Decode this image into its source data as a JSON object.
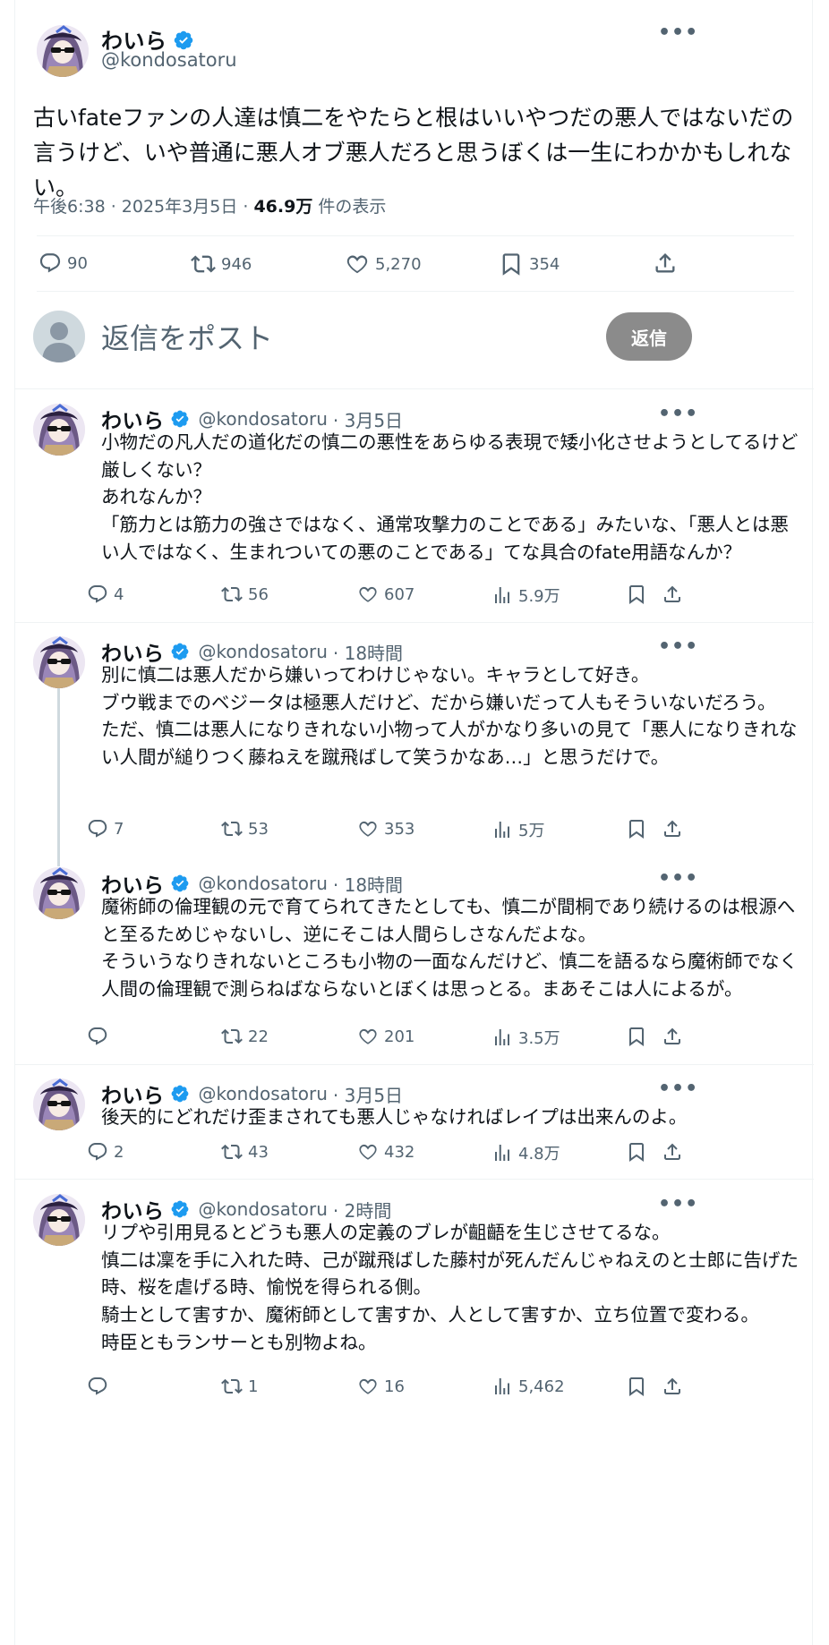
{
  "main_post": {
    "name": "わいら",
    "handle": "@kondosatoru",
    "text": "古いfateファンの人達は慎二をやたらと根はいいやつだの悪人ではないだの言うけど、いや普通に悪人オブ悪人だろと思うぼくは一生にわかかもしれない。",
    "time": "午後6:38 · 2025年3月5日 · ",
    "views": "46.9万",
    "views_suffix": " 件の表示",
    "stats": {
      "replies": "90",
      "reposts": "946",
      "likes": "5,270",
      "bookmarks": "354"
    }
  },
  "reply_composer": {
    "placeholder": "返信をポスト",
    "button": "返信"
  },
  "replies": [
    {
      "name": "わいら",
      "handle": "@kondosatoru",
      "time": "· 3月5日",
      "text": "小物だの凡人だの道化だの慎二の悪性をあらゆる表現で矮小化させようとしてるけど厳しくない？\nあれなんか？\n「筋力とは筋力の強さではなく、通常攻撃力のことである」みたいな、「悪人とは悪い人ではなく、生まれついての悪のことである」てな具合のfate用語なんか？",
      "replies": "4",
      "reposts": "56",
      "likes": "607",
      "views": "5.9万"
    },
    {
      "name": "わいら",
      "handle": "@kondosatoru",
      "time": "· 18時間",
      "text": "別に慎二は悪人だから嫌いってわけじゃない。キャラとして好き。\nブウ戦までのベジータは極悪人だけど、だから嫌いだって人もそういないだろう。\nただ、慎二は悪人になりきれない小物って人がかなり多いの見て「悪人になりきれない人間が縋りつく藤ねえを蹴飛ばして笑うかなあ…」と思うだけで。",
      "replies": "7",
      "reposts": "53",
      "likes": "353",
      "views": "5万"
    },
    {
      "name": "わいら",
      "handle": "@kondosatoru",
      "time": "· 18時間",
      "text": "魔術師の倫理観の元で育てられてきたとしても、慎二が間桐であり続けるのは根源へと至るためじゃないし、逆にそこは人間らしさなんだよな。\nそういうなりきれないところも小物の一面なんだけど、慎二を語るなら魔術師でなく人間の倫理観で測らねばならないとぼくは思っとる。まあそこは人によるが。",
      "replies": "",
      "reposts": "22",
      "likes": "201",
      "views": "3.5万"
    },
    {
      "name": "わいら",
      "handle": "@kondosatoru",
      "time": "· 3月5日",
      "text": "後天的にどれだけ歪まされても悪人じゃなければレイプは出来んのよ。",
      "replies": "2",
      "reposts": "43",
      "likes": "432",
      "views": "4.8万"
    },
    {
      "name": "わいら",
      "handle": "@kondosatoru",
      "time": "· 2時間",
      "text": "リプや引用見るとどうも悪人の定義のブレが齟齬を生じさせてるな。\n慎二は凜を手に入れた時、己が蹴飛ばした藤村が死んだんじゃねえのと士郎に告げた時、桜を虐げる時、愉悦を得られる側。\n騎士として害すか、魔術師として害すか、人として害すか、立ち位置で変わる。\n時臣ともランサーとも別物よね。",
      "replies": "",
      "reposts": "1",
      "likes": "16",
      "views": "5,462"
    }
  ],
  "colors": {
    "verified": "#1d9bf0",
    "secondary_text": "#536471",
    "divider": "#eff3f4",
    "reply_button": "#8b8b8b"
  }
}
